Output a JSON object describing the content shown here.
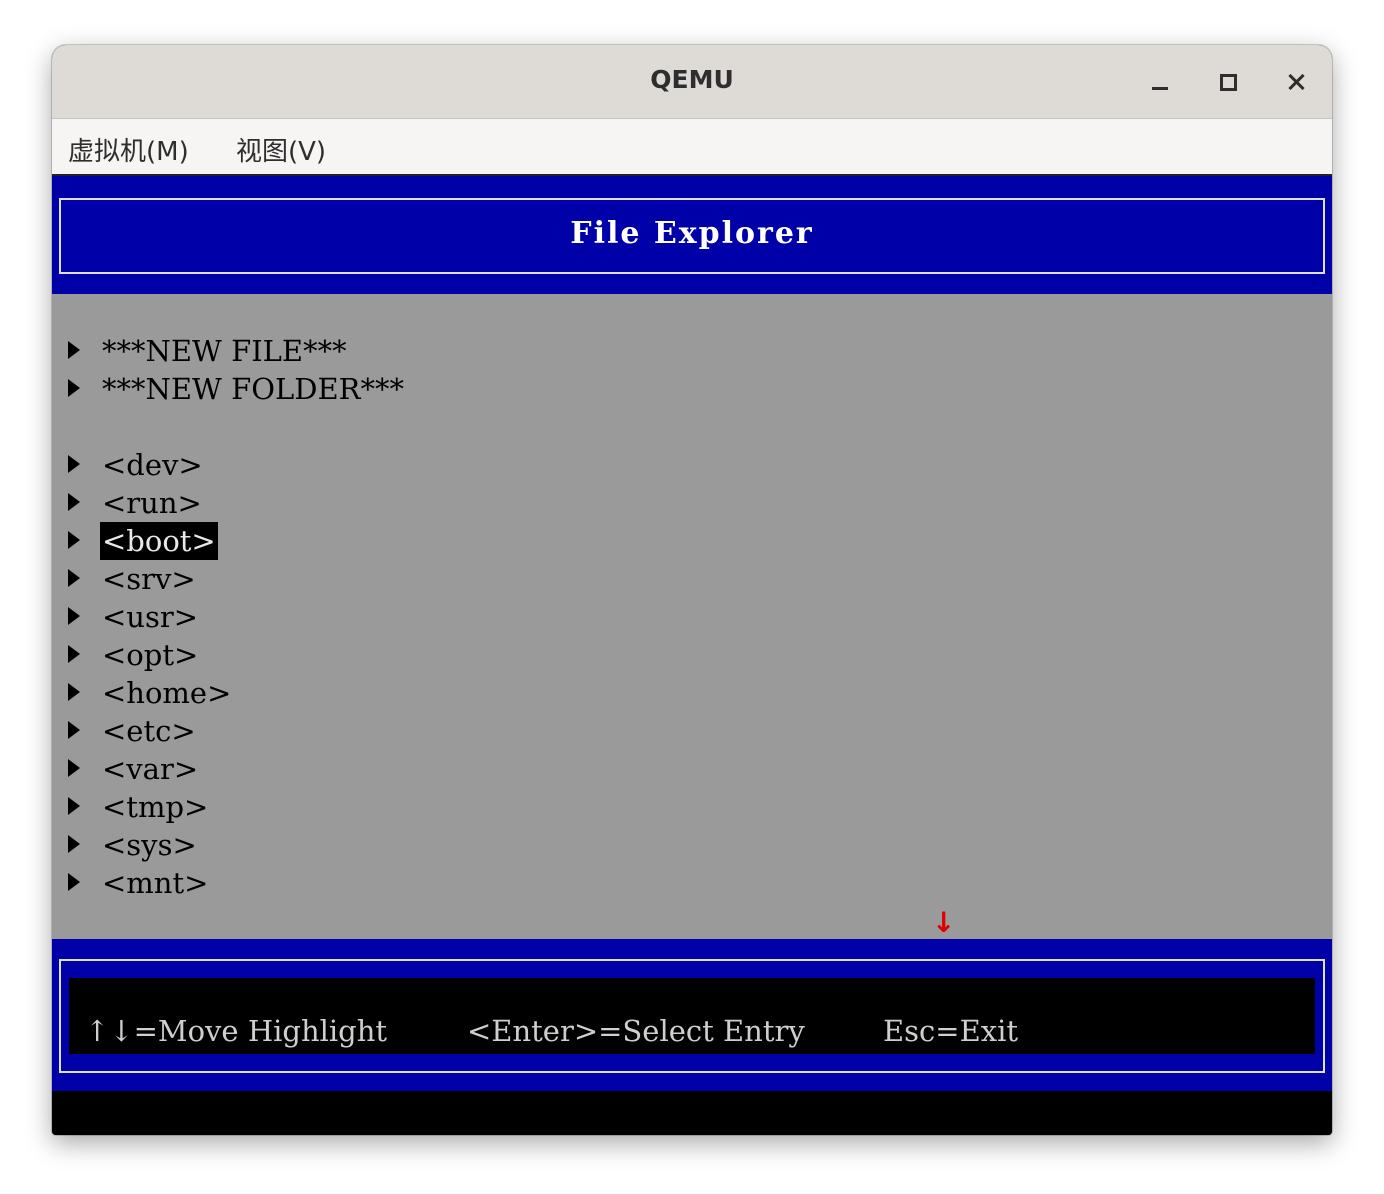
{
  "window": {
    "title": "QEMU"
  },
  "menubar": {
    "items": [
      {
        "label": "虚拟机(M)"
      },
      {
        "label": "视图(V)"
      }
    ]
  },
  "screen": {
    "header_title": "File Explorer",
    "entries": [
      {
        "label": "***NEW FILE***",
        "selected": false
      },
      {
        "label": "***NEW FOLDER***",
        "selected": false
      },
      {
        "label": "<dev>",
        "selected": false
      },
      {
        "label": "<run>",
        "selected": false
      },
      {
        "label": "<boot>",
        "selected": true
      },
      {
        "label": "<srv>",
        "selected": false
      },
      {
        "label": "<usr>",
        "selected": false
      },
      {
        "label": "<opt>",
        "selected": false
      },
      {
        "label": "<home>",
        "selected": false
      },
      {
        "label": "<etc>",
        "selected": false
      },
      {
        "label": "<var>",
        "selected": false
      },
      {
        "label": "<tmp>",
        "selected": false
      },
      {
        "label": "<sys>",
        "selected": false
      },
      {
        "label": "<mnt>",
        "selected": false
      }
    ],
    "scroll_indicator": "↓",
    "help": {
      "move": "↑↓=Move Highlight",
      "enter": "<Enter>=Select Entry",
      "esc": "Esc=Exit"
    }
  },
  "colors": {
    "bios_blue": "#0000a8",
    "bios_gray": "#9a9a9a",
    "scroll_red": "#e00000"
  }
}
